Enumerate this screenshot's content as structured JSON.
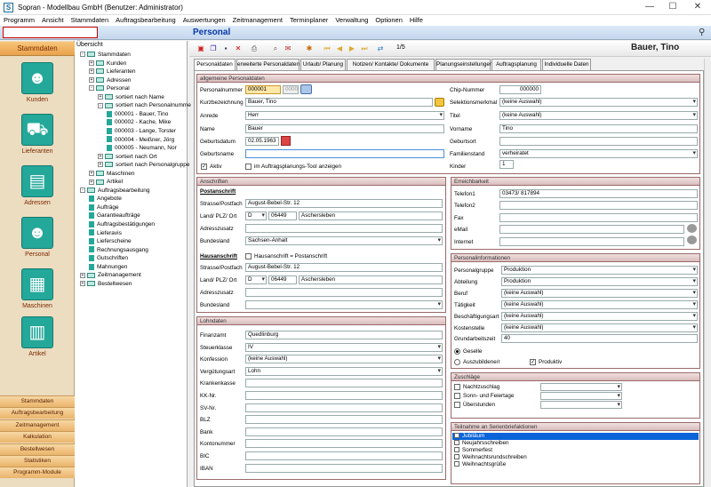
{
  "window": {
    "title": "Sopran - Modellbau GmbH (Benutzer: Administrator)",
    "app_icon": "S"
  },
  "menu": [
    "Programm",
    "Ansicht",
    "Stammdaten",
    "Auftragsbearbeitung",
    "Auswertungen",
    "Zeitmanagement",
    "Terminplaner",
    "Verwaltung",
    "Optionen",
    "Hilfe"
  ],
  "header": {
    "page_title": "Personal"
  },
  "nav": {
    "head": "Stammdaten",
    "big": [
      {
        "label": "Kunden"
      },
      {
        "label": "Lieferanten"
      },
      {
        "label": "Adressen"
      },
      {
        "label": "Personal"
      },
      {
        "label": "Maschinen"
      },
      {
        "label": "Artikel"
      }
    ],
    "buttons": [
      "Stammdaten",
      "Auftragsbearbeitung",
      "Zeitmanagement",
      "Kalkulation",
      "Bestellwesen",
      "Statistiken",
      "Programm-Module"
    ]
  },
  "tree": {
    "head": "Übersicht",
    "nodes": [
      {
        "t": "Stammdaten",
        "l": 0,
        "b": "-",
        "i": "fi"
      },
      {
        "t": "Kunden",
        "l": 1,
        "b": "+",
        "i": "fi"
      },
      {
        "t": "Lieferanten",
        "l": 1,
        "b": "+",
        "i": "fi"
      },
      {
        "t": "Adressen",
        "l": 1,
        "b": "+",
        "i": "fi"
      },
      {
        "t": "Personal",
        "l": 1,
        "b": "-",
        "i": "fi"
      },
      {
        "t": "sortiert nach Name",
        "l": 2,
        "b": "+",
        "i": "fi"
      },
      {
        "t": "sortiert nach Personalnumme",
        "l": 2,
        "b": "-",
        "i": "fi"
      },
      {
        "t": "000001 - Bauer, Tino",
        "l": 3,
        "b": "",
        "i": "pi"
      },
      {
        "t": "000002 - Kache, Mike",
        "l": 3,
        "b": "",
        "i": "pi"
      },
      {
        "t": "000003 - Lange, Torster",
        "l": 3,
        "b": "",
        "i": "pi"
      },
      {
        "t": "000004 - Meißner, Jörg",
        "l": 3,
        "b": "",
        "i": "pi"
      },
      {
        "t": "000005 - Neumann, Nor",
        "l": 3,
        "b": "",
        "i": "pi"
      },
      {
        "t": "sortiert nach Ort",
        "l": 2,
        "b": "+",
        "i": "fi"
      },
      {
        "t": "sortiert nach Personalgruppe",
        "l": 2,
        "b": "+",
        "i": "fi"
      },
      {
        "t": "Maschinen",
        "l": 1,
        "b": "+",
        "i": "fi"
      },
      {
        "t": "Artikel",
        "l": 1,
        "b": "+",
        "i": "fi"
      },
      {
        "t": "Auftragsbearbeitung",
        "l": 0,
        "b": "-",
        "i": "fi"
      },
      {
        "t": "Angebote",
        "l": 1,
        "b": "",
        "i": "pi"
      },
      {
        "t": "Aufträge",
        "l": 1,
        "b": "",
        "i": "pi"
      },
      {
        "t": "Garantieaufträge",
        "l": 1,
        "b": "",
        "i": "pi"
      },
      {
        "t": "Auftragsbestätigungen",
        "l": 1,
        "b": "",
        "i": "pi"
      },
      {
        "t": "Lieferavis",
        "l": 1,
        "b": "",
        "i": "pi"
      },
      {
        "t": "Lieferscheine",
        "l": 1,
        "b": "",
        "i": "pi"
      },
      {
        "t": "Rechnungsausgang",
        "l": 1,
        "b": "",
        "i": "pi"
      },
      {
        "t": "Gutschriften",
        "l": 1,
        "b": "",
        "i": "pi"
      },
      {
        "t": "Mahnungen",
        "l": 1,
        "b": "",
        "i": "pi"
      },
      {
        "t": "Zeitmanagement",
        "l": 0,
        "b": "+",
        "i": "fi"
      },
      {
        "t": "Bestellwesen",
        "l": 0,
        "b": "+",
        "i": "fi"
      }
    ]
  },
  "toolbar": {
    "page": "1/5",
    "record": "Bauer, Tino"
  },
  "tabs": [
    "Personaldaten",
    "erweiterte Personaldaten",
    "Urlaub/ Planung",
    "Notizen/ Kontakte/ Dokumente",
    "Planungseinstellungen",
    "Auftragsplanung",
    "Individuelle Daten"
  ],
  "allg": {
    "head": "allgemeine Personaldaten",
    "personalnummer_l": "Personalnummer",
    "personalnummer": "000001",
    "personalnummer2": "000001",
    "kurz_l": "Kurzbezeichnung",
    "kurz": "Bauer, Tino",
    "anrede_l": "Anrede",
    "anrede": "Herr",
    "name_l": "Name",
    "name": "Bauer",
    "geburtsdatum_l": "Geburtsdatum",
    "geburtsdatum": "02.05.1963",
    "geburtsname_l": "Geburtsname",
    "geburtsname": "",
    "aktiv_l": "Aktiv",
    "planung_l": "im Auftragsplanungs-Tool anzeigen",
    "chip_l": "Chip-Nummer",
    "chip": "000000",
    "selektion_l": "Selektionsmerkmal",
    "selektion": "(keine Auswahl)",
    "titel_l": "Titel",
    "titel": "(keine Auswahl)",
    "vorname_l": "Vorname",
    "vorname": "Tino",
    "geburtsort_l": "Geburtsort",
    "geburtsort": "",
    "familienstand_l": "Familienstand",
    "familienstand": "verheiratet",
    "kinder_l": "Kinder",
    "kinder": "1"
  },
  "anschriften": {
    "head": "Anschriften",
    "post": "Postanschrift",
    "strasse_l": "Strasse/Postfach",
    "strasse": "August-Bebel-Str. 12",
    "land_l": "Land/ PLZ/ Ort",
    "land": "D",
    "plz": "06449",
    "ort": "Aschersleben",
    "zusatz_l": "Adresszusatz",
    "zusatz": "",
    "bl_l": "Bundesland",
    "bl": "Sachsen-Anhalt",
    "haus": "Hausanschrift",
    "haus_chk": "Hausanschrift = Postanschrift",
    "strasse2": "August-Bebel-Str. 12",
    "land2": "D",
    "plz2": "06449",
    "ort2": "Aschersleben",
    "zusatz2": "",
    "bl2": ""
  },
  "lohn": {
    "head": "Lohndaten",
    "rows": [
      [
        "Finanzamt",
        "Quedlinburg",
        false
      ],
      [
        "Steuerklasse",
        "IV",
        true
      ],
      [
        "Konfession",
        "(keine Auswahl)",
        true
      ],
      [
        "Vergütungsart",
        "Lohn",
        true
      ],
      [
        "Krankenkasse",
        "",
        false
      ],
      [
        "KK-Nr.",
        "",
        false
      ],
      [
        "SV-Nr.",
        "",
        false
      ],
      [
        "BLZ",
        "",
        false
      ],
      [
        "Bank",
        "",
        false
      ],
      [
        "Kontonummer",
        "",
        false
      ],
      [
        "BIC",
        "",
        false
      ],
      [
        "IBAN",
        "",
        false
      ]
    ]
  },
  "erreich": {
    "head": "Erreichbarkeit",
    "rows": [
      [
        "Telefon1",
        "03473/ 817894"
      ],
      [
        "Telefon2",
        ""
      ],
      [
        "Fax",
        ""
      ],
      [
        "eMail",
        ""
      ],
      [
        "Internet",
        ""
      ]
    ]
  },
  "pinfo": {
    "head": "Personalinformationen",
    "rows": [
      [
        "Personalgruppe",
        "Produktion"
      ],
      [
        "Abteilung",
        "Produktion"
      ],
      [
        "Beruf",
        "(keine Auswahl)"
      ],
      [
        "Tätigkeit",
        "(keine Auswahl)"
      ],
      [
        "Beschäftigungsart",
        "(keine Auswahl)"
      ],
      [
        "Kostenstelle",
        "(keine Auswahl)"
      ],
      [
        "Grundarbeitszeit",
        "40"
      ]
    ],
    "geselle": "Geselle",
    "azubi": "Auszubildene/r",
    "produktiv": "Produktiv"
  },
  "zuschlaege": {
    "head": "Zuschläge",
    "rows": [
      "Nachtzuschlag",
      "Sonn- und Feiertage",
      "Überstunden"
    ]
  },
  "teilnahme": {
    "head": "Teilnahme an Serienbriefaktionen",
    "rows": [
      "Jubiläum",
      "Neujahrsschreiben",
      "Sommerfest",
      "Weihnachtsrundschreiben",
      "Weihnachtsgrüße"
    ]
  },
  "colors": {
    "accent": "#0838a8",
    "nav_bg": "#ecdcc0",
    "nav_icon": "#23a89a",
    "panel_border": "#9b6a6a",
    "selection": "#0a64d8"
  }
}
